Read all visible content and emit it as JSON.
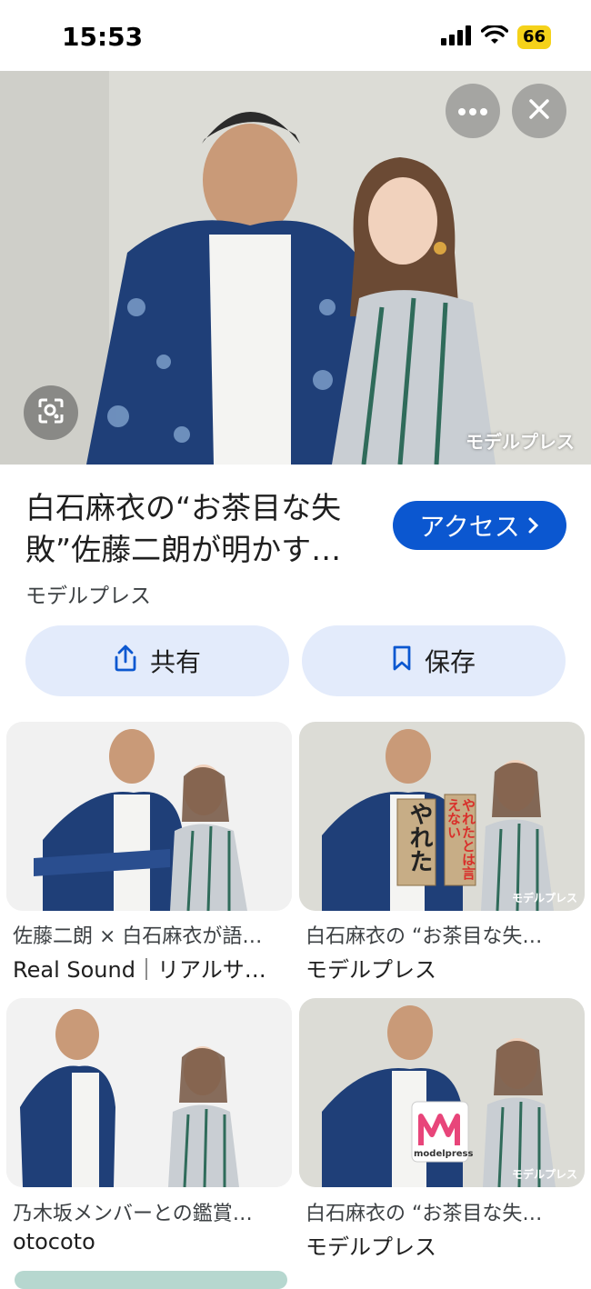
{
  "status": {
    "time": "15:53",
    "battery": "66"
  },
  "hero": {
    "watermark": "モデルプレス"
  },
  "result": {
    "title": "白石麻衣の“お茶目な失敗”佐藤二朗が明かす…",
    "source": "モデルプレス",
    "access_label": "アクセス"
  },
  "actions": {
    "share_label": "共有",
    "save_label": "保存"
  },
  "related": [
    {
      "title": "佐藤二朗 × 白石麻衣が語…",
      "source": "Real Sound｜リアルサ…"
    },
    {
      "title": "白石麻衣の “お茶目な失…",
      "source": "モデルプレス",
      "overlay": "モデルプレス"
    },
    {
      "title": "乃木坂メンバーとの鑑賞…",
      "source": "otocoto"
    },
    {
      "title": "白石麻衣の “お茶目な失…",
      "source": "モデルプレス",
      "overlay": "モデルプレス"
    }
  ],
  "signs": {
    "left": "やれた",
    "right": "やれたとは言えない",
    "badge": "modelpress"
  }
}
